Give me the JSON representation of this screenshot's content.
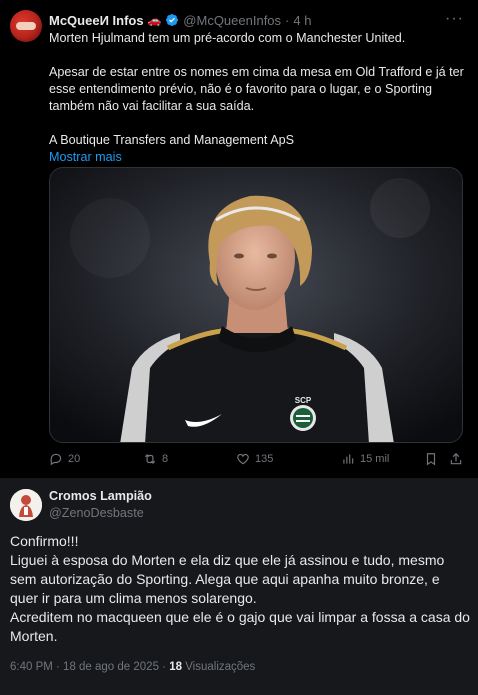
{
  "quoted": {
    "display_name": "McQueeИ Infos",
    "emoji": "🚗",
    "handle": "@McQueenInfos",
    "separator": "·",
    "time": "4 h",
    "more": "···",
    "line1": "Morten Hjulmand tem um pré-acordo com o Manchester United.",
    "line2": "Apesar de estar entre os nomes em cima da mesa em Old Trafford e já ter esse entendimento prévio, não é o favorito para o lugar, e o Sporting também não vai facilitar a sua saída.",
    "line3": "A Boutique Transfers and Management ApS",
    "show_more": "Mostrar mais",
    "media_alt": "Foto de jogador do Sporting com camisola preta e emblema SCP",
    "crest_text": "SCP",
    "actions": {
      "replies": "20",
      "retweets": "8",
      "likes": "135",
      "views": "15 mil"
    },
    "accent": "#1d9bf0"
  },
  "reply": {
    "display_name": "Cromos Lampião",
    "handle": "@ZenoDesbaste",
    "body": [
      "Confirmo!!!",
      "Liguei à esposa do Morten e ela diz que ele já assinou e tudo, mesmo sem autorização do Sporting. Alega que aqui apanha muito bronze, e quer ir para um clima menos solarengo.",
      "Acreditem no macqueen que ele é o gajo que vai limpar a fossa a casa do Morten."
    ],
    "timestamp": "6:40 PM · 18 de ago de 2025 ·",
    "views_count": "18",
    "views_label": "Visualizações"
  }
}
